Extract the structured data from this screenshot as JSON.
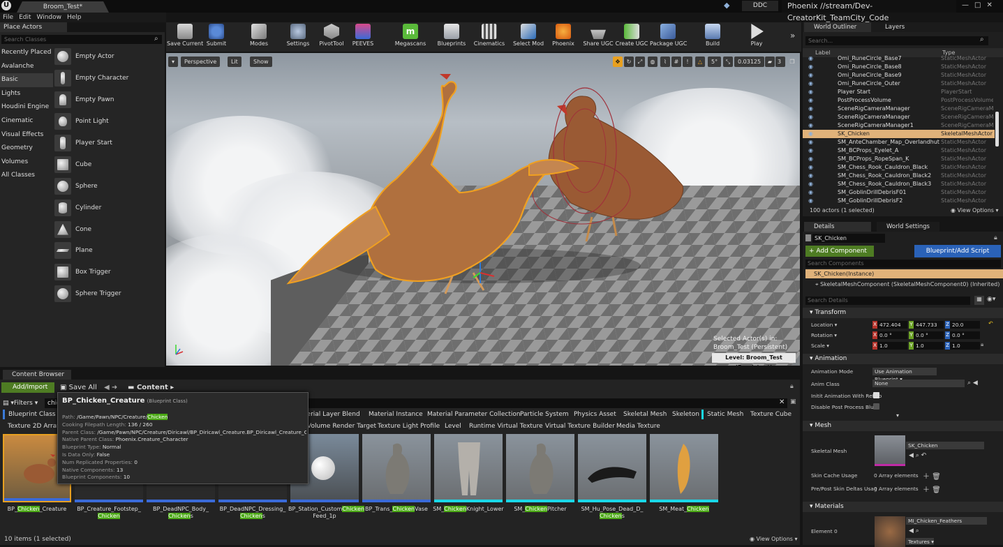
{
  "window": {
    "doc_tab": "Broom_Test*",
    "ddc": "DDC",
    "project": "Phoenix //stream/Dev-CreatorKit_TeamCity_Code"
  },
  "menu": [
    "File",
    "Edit",
    "Window",
    "Help"
  ],
  "place_actors": {
    "tab": "Place Actors",
    "search_placeholder": "Search Classes",
    "categories": [
      "Recently Placed",
      "Avalanche",
      "Basic",
      "Lights",
      "Houdini Engine",
      "Cinematic",
      "Visual Effects",
      "Geometry",
      "Volumes",
      "All Classes"
    ],
    "actors": [
      "Empty Actor",
      "Empty Character",
      "Empty Pawn",
      "Point Light",
      "Player Start",
      "Cube",
      "Sphere",
      "Cylinder",
      "Cone",
      "Plane",
      "Box Trigger",
      "Sphere Trigger"
    ]
  },
  "toolbar": [
    "Save Current",
    "Submit",
    "Modes",
    "Settings",
    "PivotTool",
    "PEEVES",
    "Megascans",
    "Blueprints",
    "Cinematics",
    "Select Mod",
    "Phoenix",
    "Share UGC",
    "Create UGC",
    "Package UGC",
    "Build",
    "Play"
  ],
  "viewport": {
    "perspective": "Perspective",
    "lit": "Lit",
    "show": "Show",
    "snap_angle": "5°",
    "scale_snap": "0.03125",
    "camera_speed": "3",
    "selected_line1": "Selected Actor(s) in:",
    "selected_line2": "Broom_Test (Persistent)",
    "level": "Level:  Broom_Test (Persistent)"
  },
  "content_browser": {
    "tab": "Content Browser",
    "add_import": "Add/Import",
    "save_all": "Save All",
    "path": "Content",
    "filters": "Filters",
    "search_value": "chic",
    "filter_chips_row1": [
      "Blueprint Class",
      "terial Layer Blend",
      "Material Instance",
      "Material Parameter Collection",
      "Particle System",
      "Physics Asset",
      "Skeletal Mesh",
      "Skeleton",
      "Static Mesh",
      "Texture Cube"
    ],
    "filter_chips_row2": [
      "Texture 2D Array",
      "Volume Render Target",
      "Texture Light Profile",
      "Level",
      "Runtime Virtual Texture",
      "Virtual Texture Builder",
      "Media Texture"
    ],
    "assets": [
      {
        "pre": "BP_",
        "hl": "Chicken",
        "post": "_Creature",
        "line2pre": "",
        "line2hl": "",
        "line2post": ""
      },
      {
        "pre": "BP_Creature_Footstep_",
        "hl": "",
        "post": "",
        "line2pre": "",
        "line2hl": "Chicken",
        "line2post": ""
      },
      {
        "pre": "BP_DeadNPC_Body_",
        "hl": "",
        "post": "",
        "line2pre": "",
        "line2hl": "Chicken",
        "line2post": "s"
      },
      {
        "pre": "BP_DeadNPC_Dressing_",
        "hl": "",
        "post": "",
        "line2pre": "",
        "line2hl": "Chicken",
        "line2post": "s"
      },
      {
        "pre": "BP_Station_Custom",
        "hl": "Chicken",
        "post": "",
        "line2pre": "Feed_1p",
        "line2hl": "",
        "line2post": ""
      },
      {
        "pre": "BP_Trans_",
        "hl": "Chicken",
        "post": "Vase",
        "line2pre": "",
        "line2hl": "",
        "line2post": ""
      },
      {
        "pre": "SM_",
        "hl": "Chicken",
        "post": "Knight_Lower",
        "line2pre": "",
        "line2hl": "",
        "line2post": ""
      },
      {
        "pre": "SM_",
        "hl": "Chicken",
        "post": "Pitcher",
        "line2pre": "",
        "line2hl": "",
        "line2post": ""
      },
      {
        "pre": "SM_Hu_Pose_Dead_D_",
        "hl": "",
        "post": "",
        "line2pre": "",
        "line2hl": "Chicken",
        "line2post": "s"
      },
      {
        "pre": "SM_Meat_",
        "hl": "Chicken",
        "post": "",
        "line2pre": "",
        "line2hl": "",
        "line2post": ""
      }
    ],
    "items_count": "10 items (1 selected)",
    "view_options": "View Options"
  },
  "tooltip": {
    "title": "BP_Chicken_Creature",
    "subtitle": "(Blueprint Class)",
    "path_label": "Path:",
    "path_value": "/Game/Pawn/NPC/Creature/",
    "path_hl": "Chicken",
    "lines": [
      {
        "k": "Cooking Filepath Length:",
        "v": "136 / 260"
      },
      {
        "k": "Parent Class:",
        "v": "/Game/Pawn/NPC/Creature/Diricawl/BP_Diricawl_Creature.BP_Diricawl_Creature_C"
      },
      {
        "k": "Native Parent Class:",
        "v": "Phoenix.Creature_Character"
      },
      {
        "k": "Blueprint Type:",
        "v": "Normal"
      },
      {
        "k": "Is Data Only:",
        "v": "False"
      },
      {
        "k": "Num Replicated Properties:",
        "v": "0"
      },
      {
        "k": "Native Components:",
        "v": "13"
      },
      {
        "k": "Blueprint Components:",
        "v": "10"
      }
    ]
  },
  "outliner": {
    "tab": "World Outliner",
    "layers_tab": "Layers",
    "search_placeholder": "Search...",
    "col_label": "Label",
    "col_type": "Type",
    "rows": [
      {
        "name": "Omi_RuneCircle_Base7",
        "type": "StaticMeshActor"
      },
      {
        "name": "Omi_RuneCircle_Base8",
        "type": "StaticMeshActor"
      },
      {
        "name": "Omi_RuneCircle_Base9",
        "type": "StaticMeshActor"
      },
      {
        "name": "Omi_RuneCircle_Outer",
        "type": "StaticMeshActor"
      },
      {
        "name": "Player Start",
        "type": "PlayerStart"
      },
      {
        "name": "PostProcessVolume",
        "type": "PostProcessVolume"
      },
      {
        "name": "SceneRigCameraManager",
        "type": "SceneRigCameraManager"
      },
      {
        "name": "SceneRigCameraManager",
        "type": "SceneRigCameraManager"
      },
      {
        "name": "SceneRigCameraManager1",
        "type": "SceneRigCameraManager"
      },
      {
        "name": "SK_Chicken",
        "type": "SkeletalMeshActor"
      },
      {
        "name": "SM_AnteChamber_Map_Overlandhut",
        "type": "StaticMeshActor"
      },
      {
        "name": "SM_BCProps_Eyelet_A",
        "type": "StaticMeshActor"
      },
      {
        "name": "SM_BCProps_RopeSpan_K",
        "type": "StaticMeshActor"
      },
      {
        "name": "SM_Chess_Rook_Cauldron_Black",
        "type": "StaticMeshActor"
      },
      {
        "name": "SM_Chess_Rook_Cauldron_Black2",
        "type": "StaticMeshActor"
      },
      {
        "name": "SM_Chess_Rook_Cauldron_Black3",
        "type": "StaticMeshActor"
      },
      {
        "name": "SM_GoblinDrillDebrisF01",
        "type": "StaticMeshActor"
      },
      {
        "name": "SM_GoblinDrillDebrisF2",
        "type": "StaticMeshActor"
      }
    ],
    "actor_count": "100 actors (1 selected)",
    "view_options": "View Options"
  },
  "details": {
    "tab": "Details",
    "world_settings_tab": "World Settings",
    "name": "SK_Chicken",
    "add_component": "+ Add Component",
    "bp_script": "Blueprint/Add Script",
    "search_components": "Search Components",
    "instance": "SK_Chicken(Instance)",
    "skel_component": "SkeletalMeshComponent (SkeletalMeshComponent0) (Inherited)",
    "search_details": "Search Details",
    "transform": "Transform",
    "location": "Location",
    "rotation": "Rotation",
    "scale": "Scale",
    "loc": [
      "472.404",
      "447.733",
      "20.0"
    ],
    "rot": [
      "0.0 °",
      "0.0 °",
      "0.0 °"
    ],
    "scl": [
      "1.0",
      "1.0",
      "1.0"
    ],
    "animation": "Animation",
    "anim_mode_label": "Animation Mode",
    "anim_mode": "Use Animation Blueprint",
    "anim_class_label": "Anim Class",
    "anim_class": "None",
    "init_anim_label": "Initit Animation With Ref Po",
    "disable_pp_label": "Disable Post Process Blue",
    "mesh": "Mesh",
    "skeletal_mesh_label": "Skeletal Mesh",
    "skeletal_mesh": "SK_Chicken",
    "skin_cache_label": "Skin Cache Usage",
    "skin_cache_value": "0 Array elements",
    "skin_deltas_label": "Pre/Post Skin Deltas Usag",
    "skin_deltas_value": "0 Array elements",
    "materials": "Materials",
    "element0_label": "Element 0",
    "element0": "MI_Chicken_Feathers",
    "textures": "Textures"
  }
}
